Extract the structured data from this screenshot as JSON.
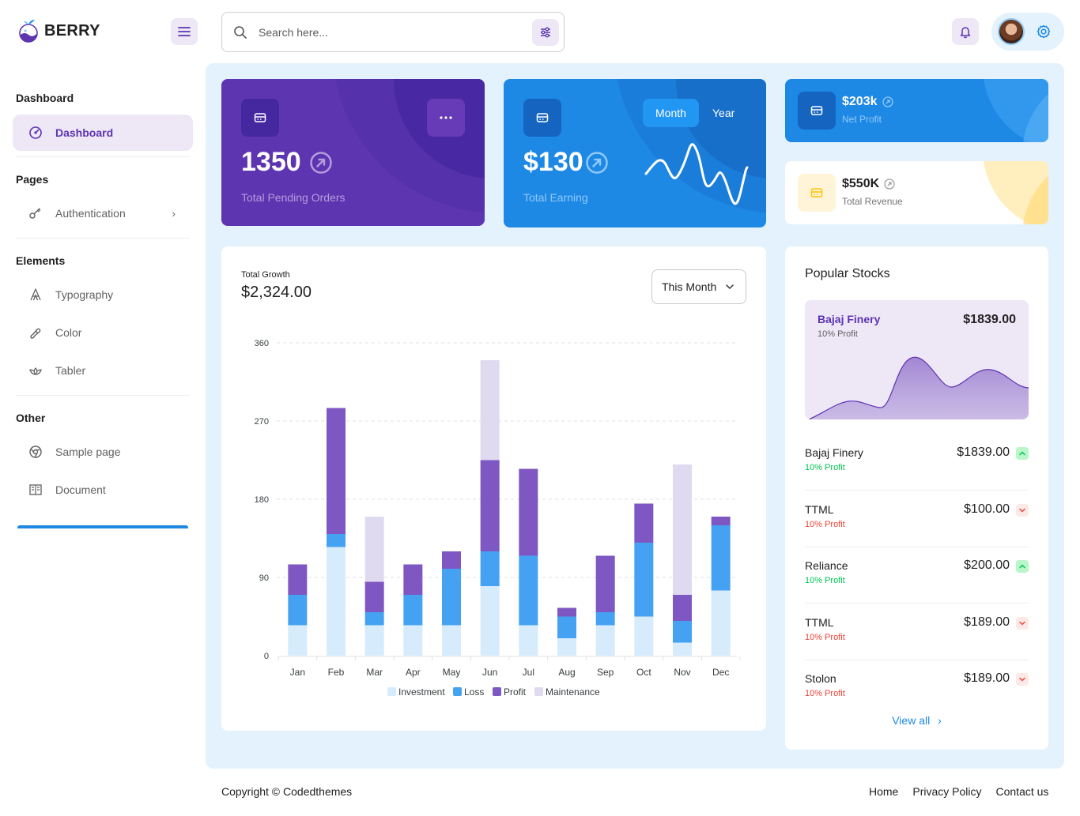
{
  "header": {
    "brand": "BERRY",
    "search_placeholder": "Search here...",
    "search_value": ""
  },
  "sidebar": {
    "groups": [
      {
        "caption": "Dashboard",
        "items": [
          {
            "label": "Dashboard",
            "icon": "dashboard-icon",
            "active": true
          }
        ]
      },
      {
        "caption": "Pages",
        "items": [
          {
            "label": "Authentication",
            "icon": "key-icon",
            "has_submenu": true
          }
        ]
      },
      {
        "caption": "Elements",
        "items": [
          {
            "label": "Typography",
            "icon": "typography-icon"
          },
          {
            "label": "Color",
            "icon": "palette-icon"
          },
          {
            "label": "Tabler",
            "icon": "lotus-icon"
          }
        ]
      },
      {
        "caption": "Other",
        "items": [
          {
            "label": "Sample page",
            "icon": "brand-chrome-icon"
          },
          {
            "label": "Document",
            "icon": "book-icon"
          }
        ]
      }
    ]
  },
  "cards": {
    "pending": {
      "value": "1350",
      "label": "Total Pending Orders"
    },
    "earning": {
      "value": "$130",
      "label": "Total Earning",
      "toggle": [
        "Month",
        "Year"
      ],
      "toggle_active": "Month"
    },
    "net_profit": {
      "value": "$203k",
      "label": "Net Profit"
    },
    "revenue": {
      "value": "$550K",
      "label": "Total Revenue"
    }
  },
  "growth": {
    "caption": "Total Growth",
    "value": "$2,324.00",
    "period": "This Month"
  },
  "chart_data": {
    "type": "bar",
    "stacked": true,
    "title": "Total Growth",
    "categories": [
      "Jan",
      "Feb",
      "Mar",
      "Apr",
      "May",
      "Jun",
      "Jul",
      "Aug",
      "Sep",
      "Oct",
      "Nov",
      "Dec"
    ],
    "series": [
      {
        "name": "Investment",
        "color": "#d6ebfb",
        "values": [
          35,
          125,
          35,
          35,
          35,
          80,
          35,
          20,
          35,
          45,
          15,
          75
        ]
      },
      {
        "name": "Loss",
        "color": "#45a2f2",
        "values": [
          35,
          15,
          15,
          35,
          65,
          40,
          80,
          25,
          15,
          85,
          25,
          75
        ]
      },
      {
        "name": "Profit",
        "color": "#7e57c2",
        "values": [
          35,
          145,
          35,
          35,
          20,
          105,
          100,
          10,
          65,
          45,
          30,
          10
        ]
      },
      {
        "name": "Maintenance",
        "color": "#e0daf0",
        "values": [
          0,
          0,
          75,
          0,
          0,
          115,
          0,
          0,
          0,
          0,
          150,
          0
        ]
      }
    ],
    "yticks": [
      0,
      90,
      180,
      270,
      360
    ],
    "ylim": [
      0,
      360
    ],
    "grid": true,
    "legend": "bottom",
    "xlabel": "",
    "ylabel": ""
  },
  "stocks": {
    "title": "Popular Stocks",
    "hero": {
      "name": "Bajaj Finery",
      "sub": "10% Profit",
      "price": "$1839.00"
    },
    "rows": [
      {
        "name": "Bajaj Finery",
        "profit": "10% Profit",
        "price": "$1839.00",
        "trend": "up"
      },
      {
        "name": "TTML",
        "profit": "10% Profit",
        "price": "$100.00",
        "trend": "down"
      },
      {
        "name": "Reliance",
        "profit": "10% Profit",
        "price": "$200.00",
        "trend": "up"
      },
      {
        "name": "TTML",
        "profit": "10% Profit",
        "price": "$189.00",
        "trend": "down"
      },
      {
        "name": "Stolon",
        "profit": "10% Profit",
        "price": "$189.00",
        "trend": "down"
      }
    ],
    "view_all": "View all"
  },
  "footer": {
    "copyright": "Copyright © Codedthemes",
    "links": [
      "Home",
      "Privacy Policy",
      "Contact us"
    ]
  },
  "colors": {
    "primary": "#5e35b1",
    "secondary": "#1e88e5",
    "success": "#00c853",
    "error": "#f44336",
    "warning": "#ffc107"
  }
}
